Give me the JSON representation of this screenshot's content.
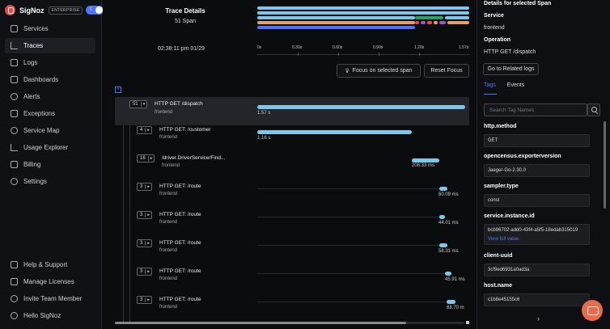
{
  "brand": {
    "name": "SigNoz",
    "edition": "ENTERPRISE"
  },
  "nav": {
    "items": [
      "Services",
      "Traces",
      "Logs",
      "Dashboards",
      "Alerts",
      "Exceptions",
      "Service Map",
      "Usage Explorer",
      "Billing",
      "Settings"
    ],
    "bottom": [
      "Help & Support",
      "Manage Licenses",
      "Invite Team Member",
      "Hello SigNoz"
    ]
  },
  "trace": {
    "title": "Trace Details",
    "span_count": "51 Span",
    "timestamp": "02:38:11 pm 01/29"
  },
  "ruler": {
    "ticks": [
      "0s",
      "0.30s",
      "0.60s",
      "0.90s",
      "1.20s",
      "1.57s"
    ]
  },
  "buttons": {
    "focus": "Focus on selected span",
    "reset": "Reset Focus"
  },
  "spans": [
    {
      "count": "51",
      "name": "HTTP GET /dispatch",
      "service": "frontend",
      "duration": "1.57 s"
    },
    {
      "count": "4",
      "name": "HTTP GET: /customer",
      "service": "frontend",
      "duration": "1.16 s"
    },
    {
      "count": "16",
      "name": "/driver.DriverService/Find...",
      "service": "frontend",
      "duration": "208.33 ms"
    },
    {
      "count": "3",
      "name": "HTTP GET: /route",
      "service": "frontend",
      "duration": "60.09 ms"
    },
    {
      "count": "3",
      "name": "HTTP GET: /route",
      "service": "frontend",
      "duration": "44.01 ms"
    },
    {
      "count": "3",
      "name": "HTTP GET: /route",
      "service": "frontend",
      "duration": "58.31 ms"
    },
    {
      "count": "3",
      "name": "HTTP GET: /route",
      "service": "frontend",
      "duration": "45.91 ms"
    },
    {
      "count": "3",
      "name": "HTTP GET: /route",
      "service": "frontend",
      "duration": "68.70 m"
    }
  ],
  "details": {
    "heading": "Details for selected Span",
    "service_label": "Service",
    "service_value": "frontend",
    "operation_label": "Operation",
    "operation_value": "HTTP GET /dispatch",
    "related_logs": "Go to Related logs"
  },
  "tabs": {
    "tags": "Tags",
    "events": "Events"
  },
  "search": {
    "placeholder": "Search Tag Names"
  },
  "tags": [
    {
      "key": "http.method",
      "value": "GET"
    },
    {
      "key": "opencensus.exporterversion",
      "value": "Jaeger-Go-2.30.0"
    },
    {
      "key": "sampler.type",
      "value": "const"
    },
    {
      "key": "service.instance.id",
      "value": "bcb96702-add0-43f4-a5f5-18edab315019",
      "link": "View full value"
    },
    {
      "key": "client-uuid",
      "value": "3cf9ed6931a0ad3a"
    },
    {
      "key": "host.name",
      "value": "c1b8e45155c6"
    }
  ],
  "colors": {
    "accent": "#4e74f8",
    "bar": "#7fc7ea"
  }
}
